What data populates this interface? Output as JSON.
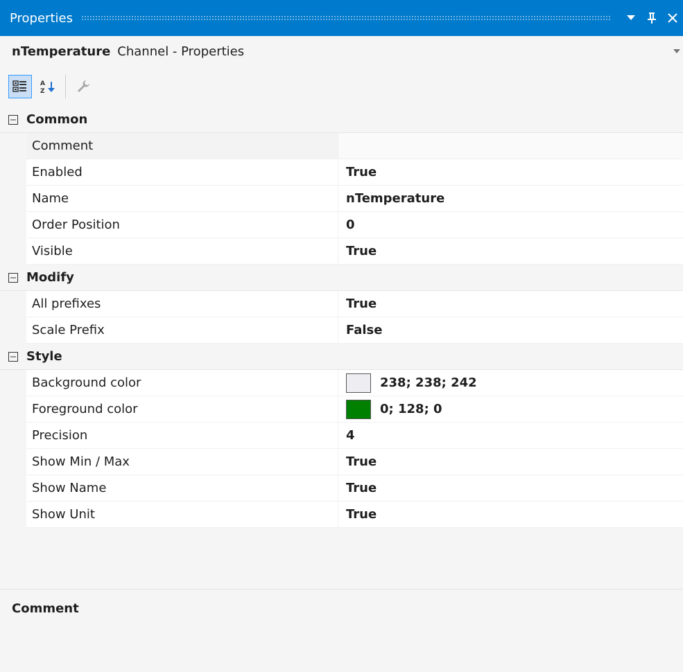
{
  "window": {
    "title": "Properties"
  },
  "header": {
    "object_name": "nTemperature",
    "object_type": "Channel - Properties"
  },
  "categories": [
    {
      "name": "Common",
      "properties": [
        {
          "name": "Comment",
          "value": ""
        },
        {
          "name": "Enabled",
          "value": "True"
        },
        {
          "name": "Name",
          "value": "nTemperature"
        },
        {
          "name": "Order Position",
          "value": "0"
        },
        {
          "name": "Visible",
          "value": "True"
        }
      ]
    },
    {
      "name": "Modify",
      "properties": [
        {
          "name": "All prefixes",
          "value": "True"
        },
        {
          "name": "Scale Prefix",
          "value": "False"
        }
      ]
    },
    {
      "name": "Style",
      "properties": [
        {
          "name": "Background color",
          "value": "238; 238; 242",
          "swatch": "#eeeef2"
        },
        {
          "name": "Foreground color",
          "value": "0; 128; 0",
          "swatch": "#008000"
        },
        {
          "name": "Precision",
          "value": "4"
        },
        {
          "name": "Show Min / Max",
          "value": "True"
        },
        {
          "name": "Show Name",
          "value": "True"
        },
        {
          "name": "Show Unit",
          "value": "True"
        }
      ]
    }
  ],
  "description": {
    "title": "Comment",
    "text": ""
  },
  "colors": {
    "titlebar": "#007acc",
    "panel": "#f5f5f5",
    "selected_toolbar_button": "#c9def5"
  }
}
